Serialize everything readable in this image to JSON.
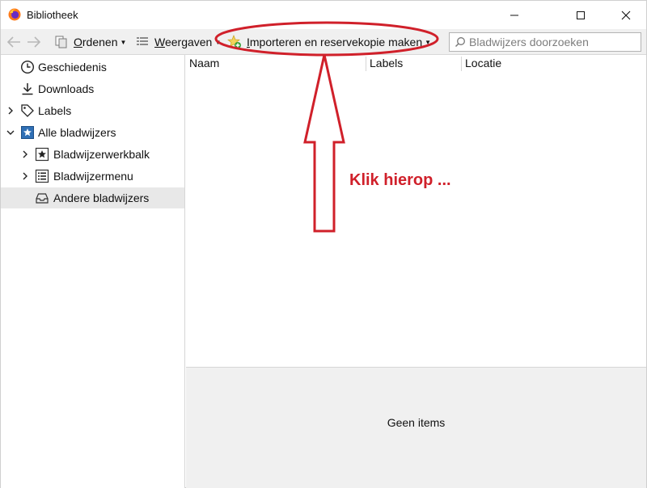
{
  "window": {
    "title": "Bibliotheek"
  },
  "toolbar": {
    "organize_label": "Ordenen",
    "views_label": "Weergaven",
    "import_label": "Importeren en reservekopie maken",
    "search_placeholder": "Bladwijzers doorzoeken"
  },
  "sidebar": {
    "items": [
      {
        "label": "Geschiedenis",
        "icon": "clock-icon"
      },
      {
        "label": "Downloads",
        "icon": "download-icon"
      },
      {
        "label": "Labels",
        "icon": "tag-icon"
      },
      {
        "label": "Alle bladwijzers",
        "icon": "bookmarks-icon"
      },
      {
        "label": "Bladwijzerwerkbalk",
        "icon": "star-icon"
      },
      {
        "label": "Bladwijzermenu",
        "icon": "list-icon"
      },
      {
        "label": "Andere bladwijzers",
        "icon": "inbox-icon"
      }
    ]
  },
  "columns": [
    "Naam",
    "Labels",
    "Locatie"
  ],
  "details": {
    "empty_text": "Geen items"
  },
  "annotation": {
    "text": "Klik hierop ...",
    "color": "#d0202a"
  }
}
